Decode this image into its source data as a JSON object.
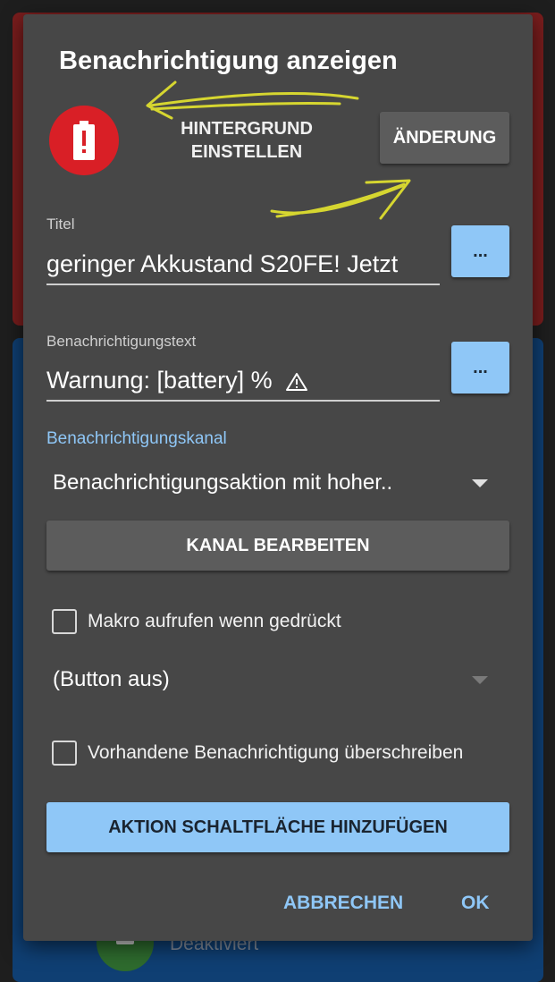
{
  "background": {
    "status_text": "Deaktiviert"
  },
  "dialog": {
    "title": "Benachrichtigung anzeigen",
    "icon": {
      "name": "battery-alert-icon",
      "color": "#d91f26"
    },
    "background_label": "HINTERGRUND\nEINSTELLEN",
    "change_button": "ÄNDERUNG",
    "title_field": {
      "label": "Titel",
      "value": "geringer Akkustand S20FE! Jetzt",
      "more_button": "..."
    },
    "text_field": {
      "label": "Benachrichtigungstext",
      "value": "Warnung: [battery] %",
      "more_button": "..."
    },
    "channel": {
      "label": "Benachrichtigungskanal",
      "selected": "Benachrichtigungsaktion mit hoher.."
    },
    "edit_channel_button": "KANAL BEARBEITEN",
    "macro_checkbox": {
      "label": "Makro aufrufen wenn gedrückt",
      "checked": false
    },
    "button_select": {
      "selected": "(Button aus)"
    },
    "overwrite_checkbox": {
      "label": "Vorhandene Benachrichtigung überschreiben",
      "checked": false
    },
    "add_action_button": "AKTION SCHALTFLÄCHE HINZUFÜGEN",
    "cancel_button": "ABBRECHEN",
    "ok_button": "OK"
  },
  "colors": {
    "accent": "#8fc7f7",
    "dialog_bg": "#474747",
    "annotation": "#e6e62e"
  }
}
